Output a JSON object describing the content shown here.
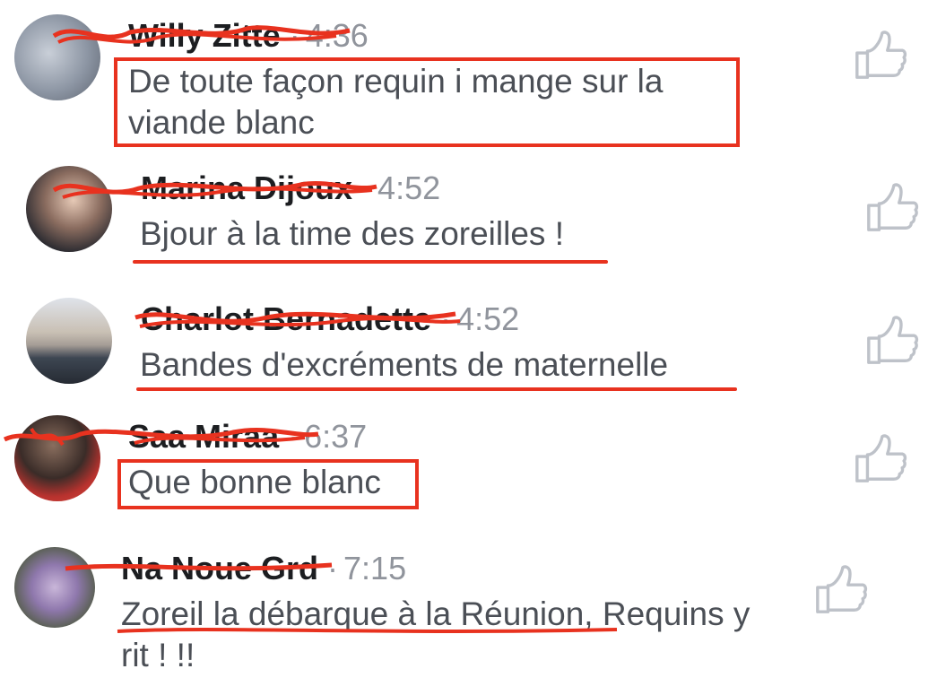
{
  "comments": [
    {
      "author": "Willy Zitte",
      "separator": "·",
      "time": "4:36",
      "text": "De toute façon requin i mange sur la viande blanc"
    },
    {
      "author": "Marina Dijoux",
      "separator": "·",
      "time": "4:52",
      "text": "Bjour à la time des zoreilles !"
    },
    {
      "author": "Charlot Bernadette",
      "separator": "·",
      "time": "4:52",
      "text": "Bandes d'excréments de maternelle"
    },
    {
      "author": "Saa Miraa",
      "separator": "·",
      "time": "6:37",
      "text": "Que bonne blanc"
    },
    {
      "author": "Na Noue Grd",
      "separator": "·",
      "time": "7:15",
      "text_underlined": "Zoreil la débarque à la Réunion,",
      "text_rest": " Requins y rit ! !!"
    }
  ],
  "colors": {
    "annotation": "#e8321f",
    "name": "#1c1e21",
    "meta": "#90949c",
    "body": "#4b4f56",
    "like": "#bec2c9"
  },
  "icons": {
    "like": "thumbs-up-icon",
    "avatar": "avatar"
  }
}
